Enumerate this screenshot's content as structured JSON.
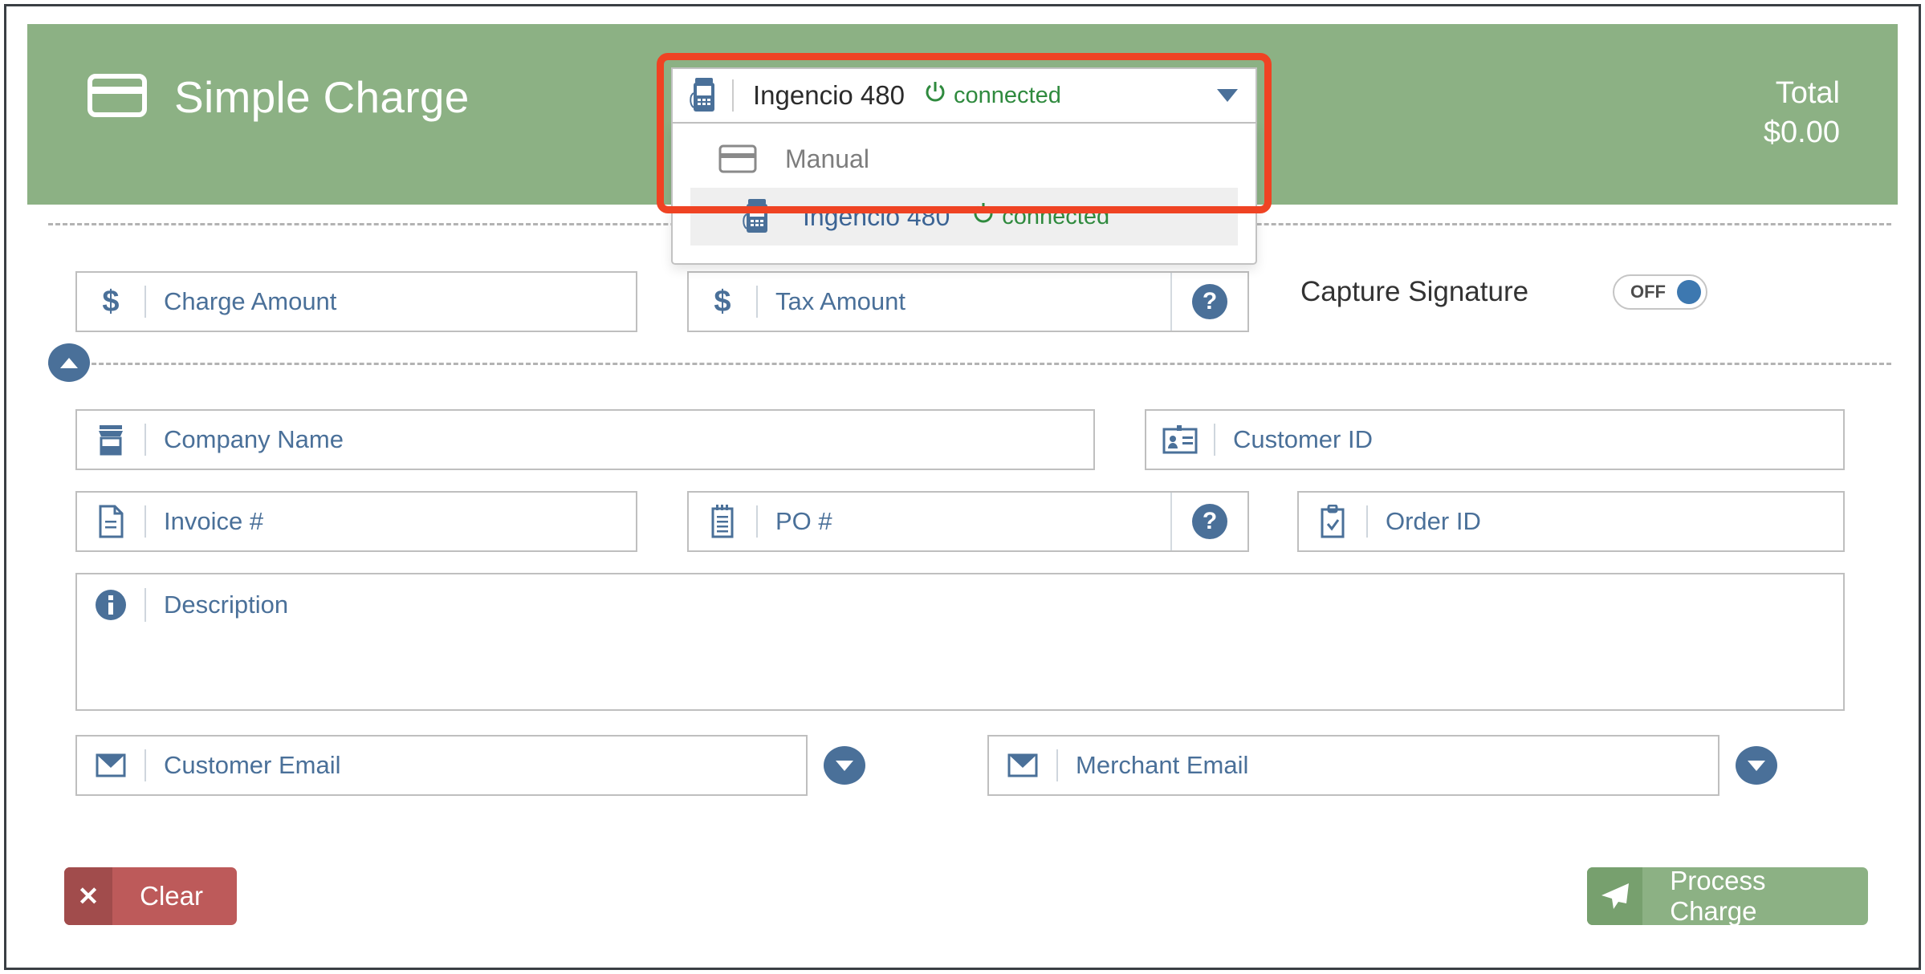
{
  "header": {
    "title": "Simple Charge",
    "card_icon": "credit-card-icon",
    "total_label": "Total",
    "total_value": "$0.00",
    "background_color": "#8cb184"
  },
  "terminal_selector": {
    "selected_label": "Ingencio 480",
    "selected_status": "connected",
    "terminal_icon": "card-terminal-icon",
    "caret_icon": "chevron-down-icon",
    "status_icon": "power-icon",
    "status_color": "#2f8a3e",
    "options": [
      {
        "label": "Manual",
        "icon": "credit-card-icon",
        "status": "",
        "selected": false
      },
      {
        "label": "Ingencio 480",
        "icon": "card-terminal-icon",
        "status": "connected",
        "selected": true
      }
    ],
    "highlight_color": "#ef4323"
  },
  "form": {
    "charge_amount": {
      "placeholder": "Charge Amount",
      "value": "",
      "icon": "dollar-sign-icon"
    },
    "tax_amount": {
      "placeholder": "Tax Amount",
      "value": "",
      "icon": "dollar-sign-icon",
      "help": "?"
    },
    "company_name": {
      "placeholder": "Company Name",
      "value": "",
      "icon": "storefront-icon"
    },
    "customer_id": {
      "placeholder": "Customer ID",
      "value": "",
      "icon": "id-card-icon"
    },
    "invoice_number": {
      "placeholder": "Invoice #",
      "value": "",
      "icon": "invoice-document-icon"
    },
    "po_number": {
      "placeholder": "PO #",
      "value": "",
      "icon": "notepad-icon",
      "help": "?"
    },
    "order_id": {
      "placeholder": "Order ID",
      "value": "",
      "icon": "clipboard-check-icon"
    },
    "description": {
      "placeholder": "Description",
      "value": "",
      "icon": "info-circle-icon"
    },
    "customer_email": {
      "placeholder": "Customer Email",
      "value": "",
      "icon": "envelope-icon",
      "caret": "chevron-down-icon"
    },
    "merchant_email": {
      "placeholder": "Merchant Email",
      "value": "",
      "icon": "envelope-icon",
      "caret": "chevron-down-icon"
    }
  },
  "capture_signature": {
    "label": "Capture Signature",
    "toggle_state": "OFF",
    "knob_color": "#3d78b0"
  },
  "collapse_toggle": {
    "icon": "chevron-up-icon"
  },
  "actions": {
    "clear": {
      "label": "Clear",
      "icon": "x-icon",
      "color": "#bd5a5a"
    },
    "process": {
      "label": "Process Charge",
      "icon": "paper-plane-icon",
      "color": "#8cb184"
    }
  }
}
